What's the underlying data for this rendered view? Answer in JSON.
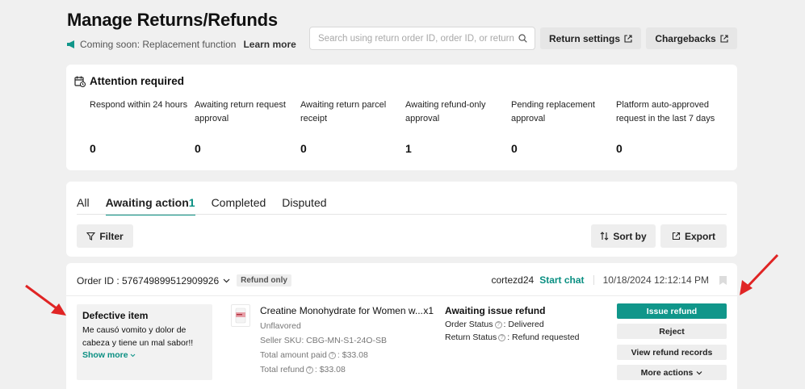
{
  "header": {
    "title": "Manage Returns/Refunds",
    "notice": "Coming soon: Replacement function",
    "notice_link": "Learn more",
    "search_placeholder": "Search using return order ID, order ID, or return ID",
    "return_settings": "Return settings",
    "chargebacks": "Chargebacks"
  },
  "attention": {
    "title": "Attention required",
    "metrics": [
      {
        "label": "Respond within 24 hours",
        "value": "0"
      },
      {
        "label": "Awaiting return request approval",
        "value": "0"
      },
      {
        "label": "Awaiting return parcel receipt",
        "value": "0"
      },
      {
        "label": "Awaiting refund-only approval",
        "value": "1"
      },
      {
        "label": "Pending replacement approval",
        "value": "0"
      },
      {
        "label": "Platform auto-approved request in the last 7 days",
        "value": "0"
      }
    ]
  },
  "tabs": {
    "all": "All",
    "awaiting": "Awaiting action",
    "awaiting_count": "1",
    "completed": "Completed",
    "disputed": "Disputed"
  },
  "toolbar": {
    "filter": "Filter",
    "sort_by": "Sort by",
    "export": "Export"
  },
  "order": {
    "order_id_label": "Order ID : 576749899512909926",
    "type_badge": "Refund only",
    "buyer": "cortezd24",
    "start_chat": "Start chat",
    "timestamp": "10/18/2024 12:12:14 PM",
    "reason_title": "Defective item",
    "reason_text": "Me causó vomito y dolor de cabeza y tiene un mal sabor!!",
    "show_more": "Show more",
    "product_name": "Creatine Monohydrate for Women w...",
    "quantity": "x1",
    "variant": "Unflavored",
    "seller_sku": "Seller SKU: CBG-MN-S1-24O-SB",
    "total_paid_label": "Total amount paid",
    "total_paid_value": ": $33.08",
    "total_refund_label": "Total refund",
    "total_refund_value": ": $33.08",
    "status_title": "Awaiting issue refund",
    "order_status_label": "Order Status",
    "order_status_value": ": Delivered",
    "return_status_label": "Return Status",
    "return_status_value": ": Refund requested",
    "actions": {
      "issue_refund": "Issue refund",
      "reject": "Reject",
      "view_records": "View refund records",
      "more_actions": "More actions"
    }
  },
  "colors": {
    "accent": "#10968a",
    "background": "#f0f0f0"
  }
}
